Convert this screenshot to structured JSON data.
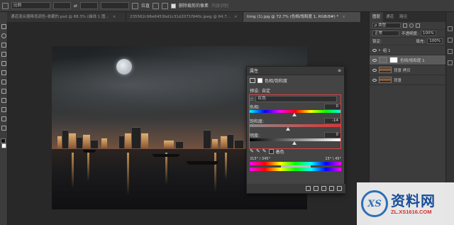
{
  "options_bar": {
    "tool_preset": "比例",
    "btn_swap": "⇄",
    "mode": "拉直",
    "delete_cropped_label": "删除裁剪的像素",
    "content_aware_label": "内容识别"
  },
  "tabs": [
    {
      "label": "通道混合器降低调色-收藏的.psd @ 88.3% (曲线 1 图...",
      "close": "×"
    },
    {
      "label": "235562c96e6453bd1c31d2071f940c.jpeg @ 64.7...",
      "close": "×"
    },
    {
      "label": "timg (1).jpg @ 72.7% (色相/饱和度 1, RGB/8#) *",
      "close": "×"
    }
  ],
  "layers_panel": {
    "tabs": [
      "图层",
      "通道",
      "路径"
    ],
    "kind_label": "ρ 类型",
    "blend_mode": "正常",
    "opacity_label": "不透明度:",
    "opacity_value": "100%",
    "lock_label": "锁定:",
    "fill_label": "填充:",
    "fill_value": "100%",
    "layers": [
      {
        "name": "组 1",
        "selected": false
      },
      {
        "name": "色相/饱和度 1",
        "selected": true
      },
      {
        "name": "背景 拷贝",
        "selected": false
      },
      {
        "name": "背景",
        "selected": false
      }
    ]
  },
  "properties_panel": {
    "title": "属性",
    "subtitle": "色相/饱和度",
    "preset_label": "预设:",
    "preset_value": "自定",
    "channel": "红色",
    "hue_label": "色相:",
    "hue_value": "0",
    "saturation_label": "饱和度:",
    "saturation_value": "-14",
    "lightness_label": "明度:",
    "lightness_value": "0",
    "colorize_label": "着色",
    "range_left": "315° / 345°",
    "range_right": "15° \\ 45°"
  },
  "watermark": {
    "logo_letters": "XS",
    "title": "资料网",
    "url": "ZL.XS1616.COM"
  },
  "colors": {
    "accent": "#d64545",
    "panel": "#444444",
    "brand_blue": "#1a4d9a"
  }
}
